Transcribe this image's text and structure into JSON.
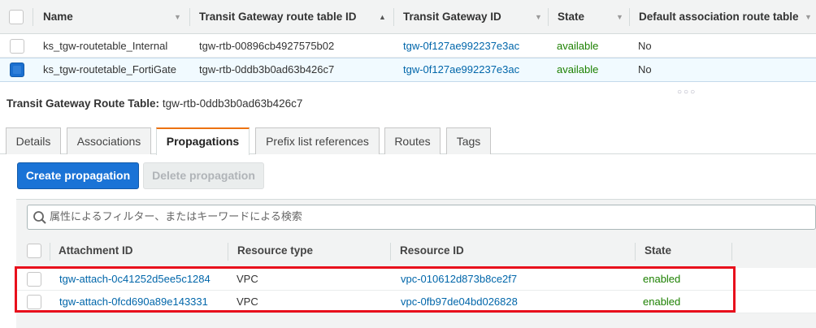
{
  "top_table": {
    "headers": [
      "Name",
      "Transit Gateway route table ID",
      "Transit Gateway ID",
      "State",
      "Default association route table"
    ],
    "rows": [
      {
        "name": "ks_tgw-routetable_Internal",
        "rtb_id": "tgw-rtb-00896cb4927575b02",
        "tgw_id": "tgw-0f127ae992237e3ac",
        "state": "available",
        "default_assoc": "No",
        "selected": false
      },
      {
        "name": "ks_tgw-routetable_FortiGate",
        "rtb_id": "tgw-rtb-0ddb3b0ad63b426c7",
        "tgw_id": "tgw-0f127ae992237e3ac",
        "state": "available",
        "default_assoc": "No",
        "selected": true
      }
    ]
  },
  "detail": {
    "title_label": "Transit Gateway Route Table:",
    "title_value": "tgw-rtb-0ddb3b0ad63b426c7"
  },
  "tabs": [
    "Details",
    "Associations",
    "Propagations",
    "Prefix list references",
    "Routes",
    "Tags"
  ],
  "active_tab": "Propagations",
  "actions": {
    "create": "Create propagation",
    "delete": "Delete propagation"
  },
  "search": {
    "placeholder": "属性によるフィルター、またはキーワードによる検索"
  },
  "prop_table": {
    "headers": [
      "Attachment ID",
      "Resource type",
      "Resource ID",
      "State"
    ],
    "rows": [
      {
        "attachment_id": "tgw-attach-0c41252d5ee5c1284",
        "resource_type": "VPC",
        "resource_id": "vpc-010612d873b8ce2f7",
        "state": "enabled"
      },
      {
        "attachment_id": "tgw-attach-0fcd690a89e143331",
        "resource_type": "VPC",
        "resource_id": "vpc-0fb97de04bd026828",
        "state": "enabled"
      }
    ]
  },
  "colors": {
    "link": "#0066aa",
    "status_green": "#1d8102",
    "primary": "#1a73d6",
    "active_tab_accent": "#ec7211",
    "highlight": "#e8101c"
  }
}
